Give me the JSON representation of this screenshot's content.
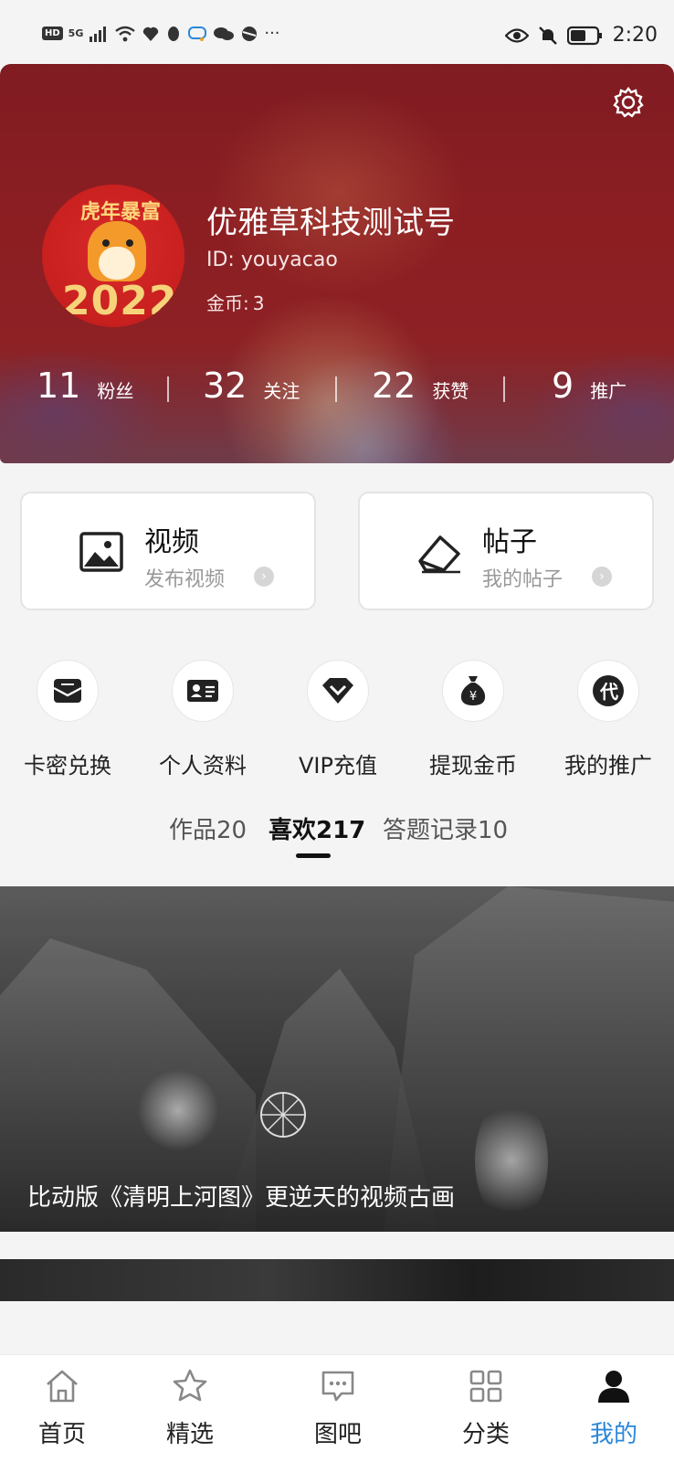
{
  "status_bar": {
    "left_badge": "HD",
    "signal": "5G",
    "more": "···",
    "time": "2:20"
  },
  "profile": {
    "avatar_tag": "虎年暴富",
    "avatar_year": "2022",
    "username": "优雅草科技测试号",
    "id_text": "ID: youyacao",
    "coins_label": "金币:",
    "coins_value": "3",
    "stats": [
      {
        "value": "11",
        "label": "粉丝"
      },
      {
        "value": "32",
        "label": "关注"
      },
      {
        "value": "22",
        "label": "获赞"
      },
      {
        "value": "9",
        "label": "推广"
      }
    ]
  },
  "cards": [
    {
      "title": "视频",
      "subtitle": "发布视频",
      "icon": "image-icon"
    },
    {
      "title": "帖子",
      "subtitle": "我的帖子",
      "icon": "eraser-edit-icon"
    }
  ],
  "quick_actions": [
    {
      "label": "卡密兑换",
      "icon": "envelope-icon"
    },
    {
      "label": "个人资料",
      "icon": "id-card-icon"
    },
    {
      "label": "VIP充值",
      "icon": "diamond-icon"
    },
    {
      "label": "提现金币",
      "icon": "money-bag-icon"
    },
    {
      "label": "我的推广",
      "icon": "dai-badge-icon",
      "glyph": "代"
    }
  ],
  "tabs": [
    {
      "label": "作品20",
      "active": false
    },
    {
      "label": "喜欢217",
      "active": true
    },
    {
      "label": "答题记录10",
      "active": false
    }
  ],
  "feed": [
    {
      "title": "比动版《清明上河图》更逆天的视频古画"
    }
  ],
  "bottom_nav": [
    {
      "label": "首页",
      "icon": "home-icon",
      "active": false
    },
    {
      "label": "精选",
      "icon": "star-icon",
      "active": false
    },
    {
      "label": "图吧",
      "icon": "chat-bubble-icon",
      "active": false
    },
    {
      "label": "分类",
      "icon": "grid-icon",
      "active": false
    },
    {
      "label": "我的",
      "icon": "user-icon",
      "active": true
    }
  ],
  "colors": {
    "header_red": "#8c1e22",
    "active_blue": "#2b87d9",
    "card_border": "#e4e4e4"
  }
}
